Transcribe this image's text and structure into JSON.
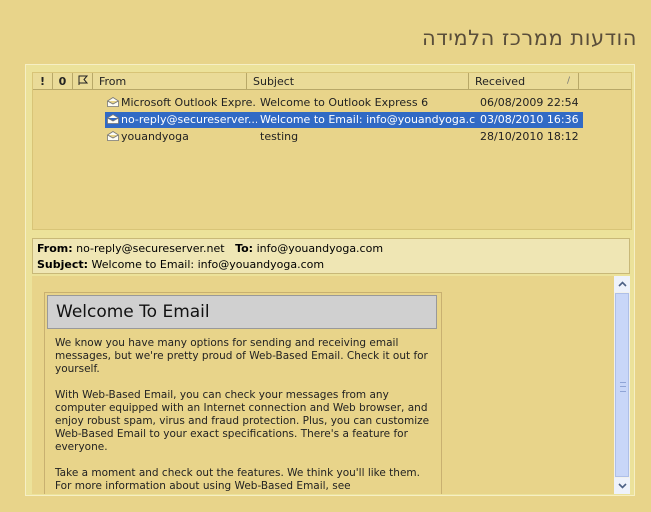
{
  "page": {
    "title": "הודעות ממרכז הלמידה"
  },
  "list": {
    "columns": {
      "priority": "!",
      "attachment": "0",
      "flag": "🏱",
      "from": "From",
      "subject": "Subject",
      "received": "Received"
    },
    "sort_indicator": "/",
    "rows": [
      {
        "from": "Microsoft Outlook Expre...",
        "subject": "Welcome to Outlook Express 6",
        "received": "06/08/2009 22:54",
        "icon": "open-envelope-icon",
        "selected": false
      },
      {
        "from": "no-reply@secureserver....",
        "subject": "Welcome to Email: info@youandyoga.com",
        "received": "03/08/2010 16:36",
        "icon": "open-envelope-icon",
        "selected": true
      },
      {
        "from": "youandyoga",
        "subject": "testing",
        "received": "28/10/2010 18:12",
        "icon": "open-envelope-icon",
        "selected": false
      }
    ]
  },
  "preview": {
    "from_label": "From:",
    "from": "no-reply@secureserver.net",
    "to_label": "To:",
    "to": "info@youandyoga.com",
    "subject_label": "Subject:",
    "subject": "Welcome to Email: info@youandyoga.com"
  },
  "message": {
    "title": "Welcome To Email",
    "p1": "We know you have many options for sending and receiving email messages, but we're pretty proud of Web-Based Email. Check it out for yourself.",
    "p2": "With Web-Based Email, you can check your messages from any computer equipped with an Internet connection and Web browser, and enjoy robust spam, virus and fraud protection. Plus, you can customize Web-Based Email to your exact specifications. There's a feature for everyone.",
    "p3": "Take a moment and check out the features. We think you'll like them. For more information about using Web-Based Email, see"
  },
  "colors": {
    "background": "#e8d48a",
    "selection": "#316ac5"
  }
}
